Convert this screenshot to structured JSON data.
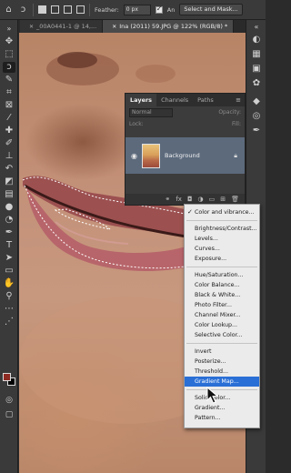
{
  "options_bar": {
    "feather_label": "Feather:",
    "feather_value": "0 px",
    "antialias_label": "An",
    "select_mask_label": "Select and Mask..."
  },
  "doc_tabs": [
    {
      "label": "_00A0441-1 @ 14,...",
      "active": false
    },
    {
      "label": "Ina (2011) 59.JPG @ 122% (RGB/8) *",
      "active": true
    }
  ],
  "layers_panel": {
    "tabs": [
      "Layers",
      "Channels",
      "Paths"
    ],
    "blend_mode": "Normal",
    "opacity_label": "Opacity:",
    "lock_label": "Lock:",
    "fill_label": "Fill:",
    "layer_name": "Background"
  },
  "adjustment_menu": {
    "items": [
      {
        "label": "Color and vibrance...",
        "checked": true
      },
      {
        "sep": true
      },
      {
        "label": "Brightness/Contrast..."
      },
      {
        "label": "Levels..."
      },
      {
        "label": "Curves..."
      },
      {
        "label": "Exposure..."
      },
      {
        "sep": true
      },
      {
        "label": "Hue/Saturation..."
      },
      {
        "label": "Color Balance..."
      },
      {
        "label": "Black & White..."
      },
      {
        "label": "Photo Filter..."
      },
      {
        "label": "Channel Mixer..."
      },
      {
        "label": "Color Lookup..."
      },
      {
        "label": "Selective Color..."
      },
      {
        "sep": true
      },
      {
        "label": "Invert"
      },
      {
        "label": "Posterize..."
      },
      {
        "label": "Threshold..."
      },
      {
        "label": "Gradient Map...",
        "highlighted": true
      },
      {
        "sep": true
      },
      {
        "label": "Solid Color..."
      },
      {
        "label": "Gradient..."
      },
      {
        "label": "Pattern..."
      }
    ]
  },
  "colors": {
    "foreground": "#8d2a22",
    "background": "#000000",
    "menu_highlight": "#2a6fd6",
    "layer_selected": "#5c6a7c"
  }
}
